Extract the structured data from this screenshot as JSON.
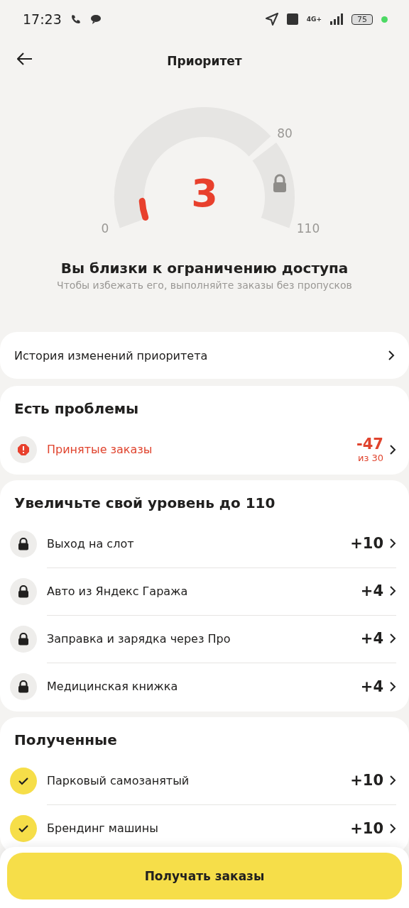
{
  "status_bar": {
    "time": "17:23",
    "network": "4G+",
    "battery": "75"
  },
  "header": {
    "title": "Приоритет"
  },
  "gauge": {
    "value": "3",
    "min_label": "0",
    "threshold_label": "80",
    "max_label": "110"
  },
  "status": {
    "title": "Вы близки к ограничению доступа",
    "subtitle": "Чтобы избежать его, выполняйте заказы без пропусков"
  },
  "history_link": "История изменений приоритета",
  "sections": [
    {
      "title": "Есть проблемы",
      "items": [
        {
          "kind": "problem",
          "label": "Принятые заказы",
          "value": "-47",
          "note": "из 30"
        }
      ]
    },
    {
      "title": "Увеличьте свой уровень до 110",
      "items": [
        {
          "kind": "locked",
          "label": "Выход на слот",
          "value": "+10"
        },
        {
          "kind": "locked",
          "label": "Авто из Яндекс Гаража",
          "value": "+4"
        },
        {
          "kind": "locked",
          "label": "Заправка и зарядка через Про",
          "value": "+4"
        },
        {
          "kind": "locked",
          "label": "Медицинская книжка",
          "value": "+4"
        }
      ]
    },
    {
      "title": "Полученные",
      "items": [
        {
          "kind": "done",
          "label": "Парковый самозанятый",
          "value": "+10"
        },
        {
          "kind": "done",
          "label": "Брендинг машины",
          "value": "+10"
        }
      ]
    }
  ],
  "action_button": "Получать заказы"
}
